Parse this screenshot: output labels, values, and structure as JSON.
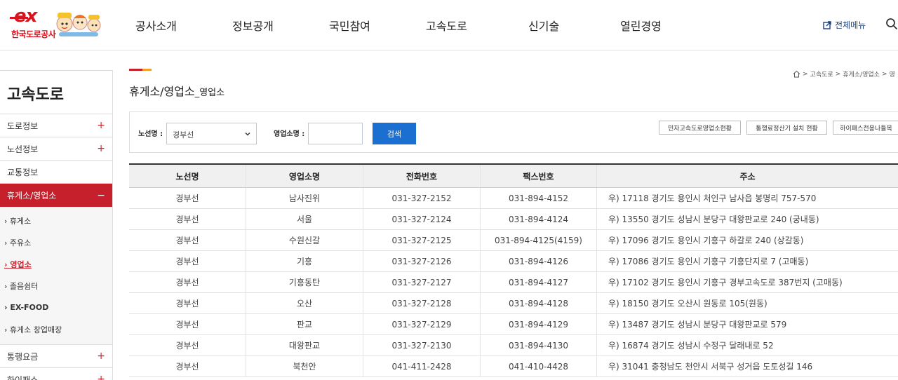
{
  "header": {
    "logo_text": "한국도로공사",
    "logo_ex": "ex",
    "nav": [
      "공사소개",
      "정보공개",
      "국민참여",
      "고속도로",
      "신기술",
      "열린경영"
    ],
    "allmenu_label": "전체메뉴",
    "icons": {
      "allmenu": "external-link-icon",
      "search": "search-icon"
    }
  },
  "sidebar": {
    "title": "고속도로",
    "items_top": [
      {
        "label": "도로정보",
        "toggle": "+"
      },
      {
        "label": "노선정보",
        "toggle": "+"
      },
      {
        "label": "교통정보",
        "toggle": ""
      }
    ],
    "active": {
      "label": "휴게소/영업소",
      "toggle": "−"
    },
    "sub_items": [
      "› 휴게소",
      "› 주유소",
      "› 영업소",
      "› 졸음쉼터",
      "› EX-FOOD",
      "› 휴게소 창업매장"
    ],
    "items_bottom": [
      {
        "label": "통행요금",
        "toggle": "+"
      },
      {
        "label": "하이패스",
        "toggle": "+"
      }
    ],
    "accent_color": "#c6202c"
  },
  "main": {
    "title": "휴게소/영업소",
    "title_suffix": "_영업소",
    "breadcrumb": [
      "고속도로",
      "휴게소/영업소",
      "영"
    ],
    "search": {
      "route_label": "노선명 :",
      "route_value": "경부선",
      "office_label": "영업소명 :",
      "office_value": "",
      "button": "검색"
    },
    "links": [
      "민자고속도로영업소현황",
      "통행료정산기 설치 현황",
      "하이패스전용나들목"
    ]
  },
  "table": {
    "headers": [
      "노선명",
      "영업소명",
      "전화번호",
      "팩스번호",
      "주소"
    ],
    "rows": [
      [
        "경부선",
        "남사진위",
        "031-327-2152",
        "031-894-4152",
        "우) 17118 경기도 용인시 처인구 남사읍 봉명리 757-570"
      ],
      [
        "경부선",
        "서울",
        "031-327-2124",
        "031-894-4124",
        "우) 13550 경기도 성남시 분당구 대왕판교로 240 (궁내동)"
      ],
      [
        "경부선",
        "수원신갈",
        "031-327-2125",
        "031-894-4125(4159)",
        "우) 17096 경기도 용인시 기흥구 하갈로 240 (상갈동)"
      ],
      [
        "경부선",
        "기흥",
        "031-327-2126",
        "031-894-4126",
        "우) 17086 경기도 용인시 기흥구 기흥단지로 7 (고매동)"
      ],
      [
        "경부선",
        "기흥동탄",
        "031-327-2127",
        "031-894-4127",
        "우) 17102 경기도 용인시 기흥구 경부고속도로 387번지 (고매동)"
      ],
      [
        "경부선",
        "오산",
        "031-327-2128",
        "031-894-4128",
        "우) 18150 경기도 오산시 원동로 105(원동)"
      ],
      [
        "경부선",
        "판교",
        "031-327-2129",
        "031-894-4129",
        "우) 13487 경기도 성남시 분당구 대왕판교로 579"
      ],
      [
        "경부선",
        "대왕판교",
        "031-327-2130",
        "031-894-4130",
        "우) 16874 경기도 성남시 수정구 달래내로 52"
      ],
      [
        "경부선",
        "북천안",
        "041-411-2428",
        "041-410-4428",
        "우) 31041 충청남도 천안시 서북구 성거읍 도토성길 146"
      ]
    ]
  }
}
